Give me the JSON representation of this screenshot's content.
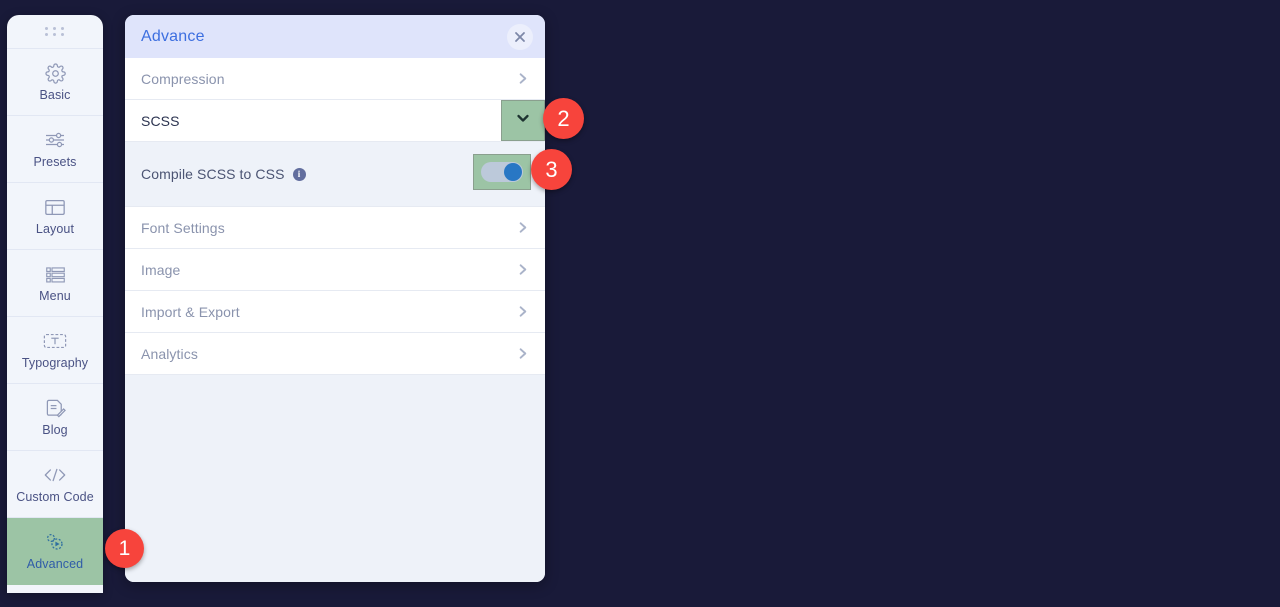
{
  "sidebar": {
    "drag_handle_icon": "drag-dots-icon",
    "items": [
      {
        "label": "Basic",
        "icon": "gear-icon",
        "active": false
      },
      {
        "label": "Presets",
        "icon": "sliders-icon",
        "active": false
      },
      {
        "label": "Layout",
        "icon": "layout-icon",
        "active": false
      },
      {
        "label": "Menu",
        "icon": "list-icon",
        "active": false
      },
      {
        "label": "Typography",
        "icon": "text-box-icon",
        "active": false
      },
      {
        "label": "Blog",
        "icon": "document-pen-icon",
        "active": false
      },
      {
        "label": "Custom Code",
        "icon": "code-brackets-icon",
        "active": false
      },
      {
        "label": "Advanced",
        "icon": "advanced-gear-icon",
        "active": true
      }
    ]
  },
  "panel": {
    "title": "Advance",
    "close_icon": "close-icon",
    "rows": [
      {
        "label": "Compression",
        "type": "link",
        "icon": "chevron-right-icon"
      },
      {
        "label": "SCSS",
        "type": "dropdown",
        "icon": "chevron-down-icon"
      },
      {
        "label": "Compile SCSS to CSS",
        "type": "toggle",
        "icon": "info-icon",
        "toggle_state": "on"
      },
      {
        "label": "Font Settings",
        "type": "link",
        "icon": "chevron-right-icon"
      },
      {
        "label": "Image",
        "type": "link",
        "icon": "chevron-right-icon"
      },
      {
        "label": "Import & Export",
        "type": "link",
        "icon": "chevron-right-icon"
      },
      {
        "label": "Analytics",
        "type": "link",
        "icon": "chevron-right-icon"
      }
    ]
  },
  "steps": [
    {
      "number": "1",
      "target": "sidebar-item-advanced"
    },
    {
      "number": "2",
      "target": "scss-dropdown-button"
    },
    {
      "number": "3",
      "target": "compile-scss-toggle"
    }
  ],
  "colors": {
    "background": "#191a39",
    "panel_header": "#dfe4fb",
    "panel_body": "#eef2f9",
    "accent_blue": "#3d6fe0",
    "highlight_green": "#9cc4a5",
    "badge_red": "#f7443c",
    "toggle_knob": "#2877c4"
  }
}
